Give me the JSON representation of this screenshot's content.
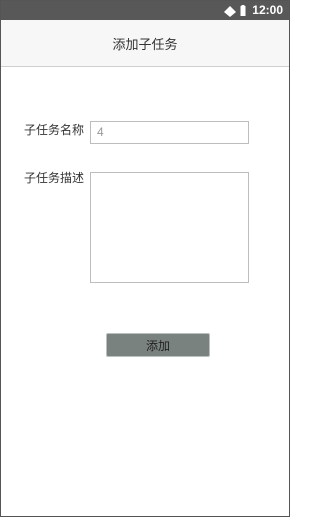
{
  "status_bar": {
    "time": "12:00",
    "icons": [
      "wifi-icon",
      "battery-icon"
    ]
  },
  "app_bar": {
    "title": "添加子任务"
  },
  "form": {
    "name_label": "子任务名称",
    "name_value": "4",
    "description_label": "子任务描述",
    "description_value": ""
  },
  "actions": {
    "add_label": "添加"
  },
  "colors": {
    "status_bar": "#585858",
    "app_bar": "#f7f7f7",
    "button": "#7a8280"
  }
}
